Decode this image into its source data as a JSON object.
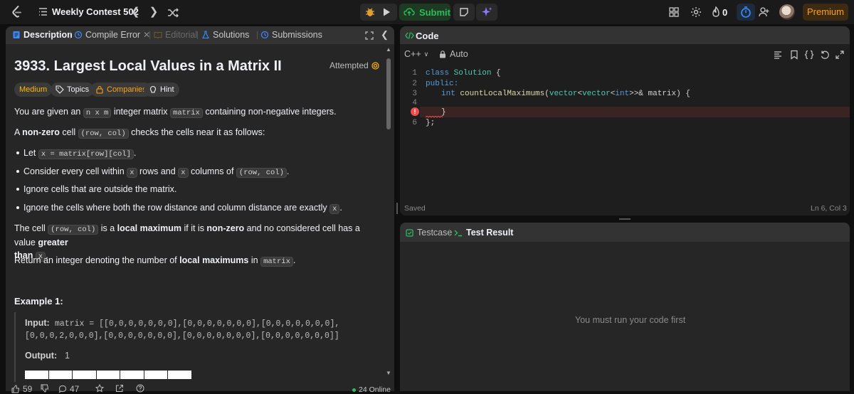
{
  "topbar": {
    "contest_title": "Weekly Contest 502",
    "submit_label": "Submit",
    "count": "0",
    "premium_label": "Premium"
  },
  "left_tabs": {
    "description": "Description",
    "compile_error": "Compile Error",
    "editorial": "Editorial",
    "solutions": "Solutions",
    "submissions": "Submissions"
  },
  "problem": {
    "title": "3933. Largest Local Values in a Matrix II",
    "status": "Attempted",
    "chips": {
      "difficulty": "Medium",
      "topics": "Topics",
      "companies": "Companies",
      "hint": "Hint"
    },
    "p1": {
      "a": "You are given an ",
      "code1": "n x m",
      "b": " integer matrix ",
      "code2": "matrix",
      "c": " containing non-negative integers."
    },
    "p2": {
      "a": "A ",
      "bold": "non-zero",
      "b": " cell ",
      "code": "(row, col)",
      "c": " checks the cells near it as follows:"
    },
    "bullets": {
      "b1": {
        "a": "Let ",
        "code": "x = matrix[row][col]",
        "b": "."
      },
      "b2": {
        "a": "Consider every cell within ",
        "code1": "x",
        "b": " rows and ",
        "code2": "x",
        "c": " columns of ",
        "code3": "(row, col)",
        "d": "."
      },
      "b3": {
        "a": "Ignore cells that are outside the matrix."
      },
      "b4": {
        "a": "Ignore the cells where both the row distance and column distance are exactly ",
        "code": "x",
        "b": "."
      }
    },
    "p3": {
      "a": "The cell ",
      "code1": "(row, col)",
      "b": " is a ",
      "bold1": "local maximum",
      "c": " if it is ",
      "bold2": "non-zero",
      "d": " and no considered cell has a value ",
      "bold3": "greater",
      "bold4": "than",
      "code2": "x",
      "e": "."
    },
    "p4": {
      "a": "Return an integer denoting the number of ",
      "bold": "local maximums",
      "b": " in ",
      "code": "matrix",
      "c": "."
    },
    "example_title": "Example 1:",
    "example_input_label": "Input:",
    "example_input_line1": "matrix = [[0,0,0,0,0,0,0],[0,0,0,0,0,0,0],[0,0,0,0,0,0,0],",
    "example_input_line2": "[0,0,0,2,0,0,0],[0,0,0,0,0,0,0],[0,0,0,0,0,0,0],[0,0,0,0,0,0,0]]",
    "example_output_label": "Output:",
    "example_output_val": "1"
  },
  "footer": {
    "likes": "59",
    "comments": "47",
    "online": "24 Online"
  },
  "code": {
    "header": "Code",
    "language": "C++",
    "mode": "Auto",
    "lines": {
      "n1": "1",
      "n2": "2",
      "n3": "3",
      "n4": "4",
      "n6": "6",
      "l1a": "class",
      "l1b": "Solution",
      "l1c": " {",
      "l2": "public:",
      "l3a": "int",
      "l3b": "countLocalMaximums",
      "l3c": "(",
      "l3d": "vector",
      "l3e": "<",
      "l3f": "vector",
      "l3g": "<",
      "l3h": "int",
      "l3i": ">>& matrix) {",
      "l5": "}",
      "l6": "};"
    },
    "error_marker": "!",
    "saved": "Saved",
    "cursor": "Ln 6, Col 3"
  },
  "test": {
    "testcase_tab": "Testcase",
    "result_tab": "Test Result",
    "empty_message": "You must run your code first"
  }
}
